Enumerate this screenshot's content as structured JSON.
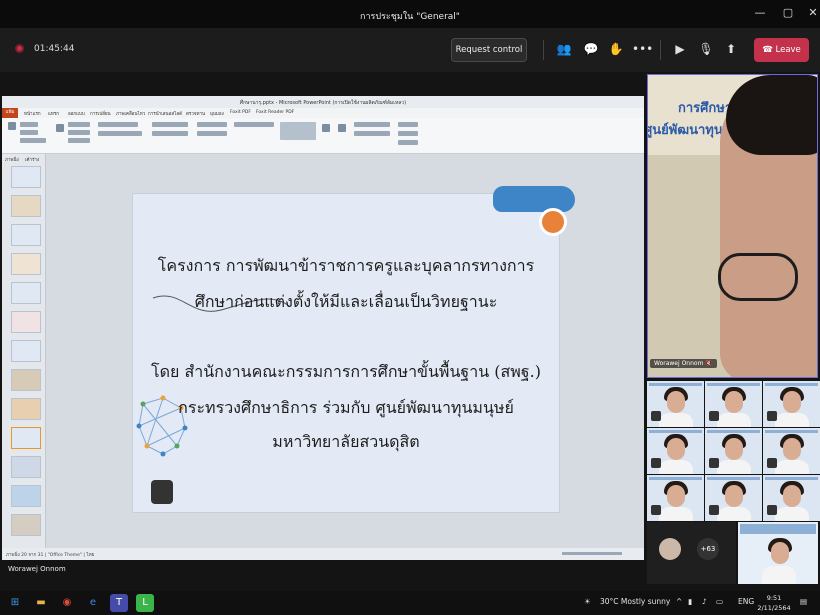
{
  "window": {
    "title": "การประชุมใน \"General\""
  },
  "toolbar": {
    "timer": "01:45:44",
    "request_control": "Request control",
    "leave": "Leave"
  },
  "ppt": {
    "window_title": "ศึกษานารุ.pptx - Microsoft PowerPoint (การเปิดใช้งานผลิตภัณฑ์ล้มเหลว)",
    "file_tab": "แฟ้ม",
    "tabs": [
      "หน้าแรก",
      "แทรก",
      "ออกแบบ",
      "การเปลี่ยน",
      "ภาพเคลื่อนไหว",
      "การนำเสนอสไลด์",
      "ตรวจทาน",
      "มุมมอง",
      "Foxit PDF",
      "Foxit Reader PDF"
    ],
    "panel_tabs": [
      "ภาพนิ่ง",
      "เค้าร่าง"
    ],
    "status": "ภาพนิ่ง 20 จาก 31 | \"Office Theme\" | ไทย",
    "slide_lines": [
      "โครงการ การพัฒนาข้าราชการครูและบุคลากรทางการ",
      "ศึกษาก่อนแต่งตั้งให้มีและเลื่อนเป็นวิทยฐานะ",
      "โดย สำนักงานคณะกรรมการการศึกษาขั้นพื้นฐาน (สพฐ.)",
      "กระทรวงศึกษาธิการ ร่วมกับ ศูนย์พัฒนาทุนมนุษย์",
      "มหาวิทยาลัยสวนดุสิต"
    ]
  },
  "participants": {
    "main_name": "Worawej Onnom",
    "banner_line1": "การศึกษาต",
    "banner_line2": "ศูนย์พัฒนาทุนมน",
    "overflow_count": "+63"
  },
  "bottom_label": "Worawej Onnom",
  "taskbar": {
    "weather": "30°C  Mostly sunny",
    "lang": "ENG",
    "time": "9:51",
    "date": "2/11/2564"
  },
  "colors": {
    "leave": "#c4314b",
    "ppt_file_tab": "#c4451c",
    "accent_blue": "#3d85c6",
    "accent_orange": "#e8823b"
  }
}
